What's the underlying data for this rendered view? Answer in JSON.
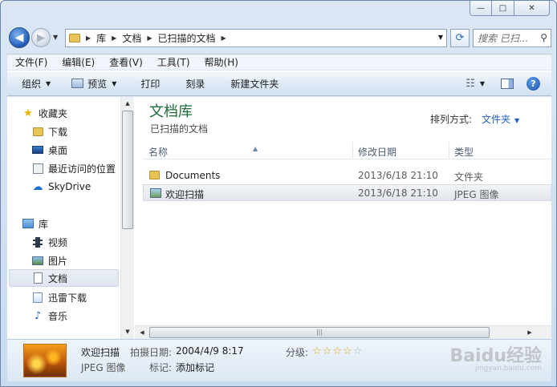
{
  "caption": {
    "minimize": "—",
    "maximize": "□",
    "close": "✕"
  },
  "nav": {
    "back_glyph": "◀",
    "forward_glyph": "▶",
    "breadcrumbs": [
      "库",
      "文档",
      "已扫描的文档"
    ],
    "search_placeholder": "搜索 已扫...",
    "refresh_glyph": "⟳"
  },
  "menubar": [
    "文件(F)",
    "编辑(E)",
    "查看(V)",
    "工具(T)",
    "帮助(H)"
  ],
  "toolbar": {
    "organize": "组织",
    "preview": "预览",
    "print": "打印",
    "burn": "刻录",
    "new_folder": "新建文件夹",
    "help": "?"
  },
  "sidebar": {
    "favorites": "收藏夹",
    "downloads": "下载",
    "desktop": "桌面",
    "recent": "最近访问的位置",
    "skydrive": "SkyDrive",
    "libraries": "库",
    "videos": "视频",
    "pictures": "图片",
    "documents": "文档",
    "thunder": "迅雷下载",
    "music": "音乐"
  },
  "library": {
    "title": "文档库",
    "subtitle": "已扫描的文档",
    "arrange_label": "排列方式:",
    "arrange_value": "文件夹"
  },
  "columns": {
    "name": "名称",
    "modified": "修改日期",
    "type": "类型"
  },
  "files": [
    {
      "name": "Documents",
      "modified": "2013/6/18 21:10",
      "type": "文件夹",
      "icon": "folder-icon"
    },
    {
      "name": "欢迎扫描",
      "modified": "2013/6/18 21:10",
      "type": "JPEG 图像",
      "icon": "image-icon"
    }
  ],
  "details": {
    "name": "欢迎扫描",
    "type": "JPEG 图像",
    "taken_label": "拍摄日期:",
    "taken_value": "2004/4/9 8:17",
    "tags_label": "标记:",
    "tags_value": "添加标记",
    "rating_label": "分级:",
    "rating": 0
  },
  "watermark": {
    "main": "Baidu经验",
    "sub": "jingyan.baidu.com"
  }
}
